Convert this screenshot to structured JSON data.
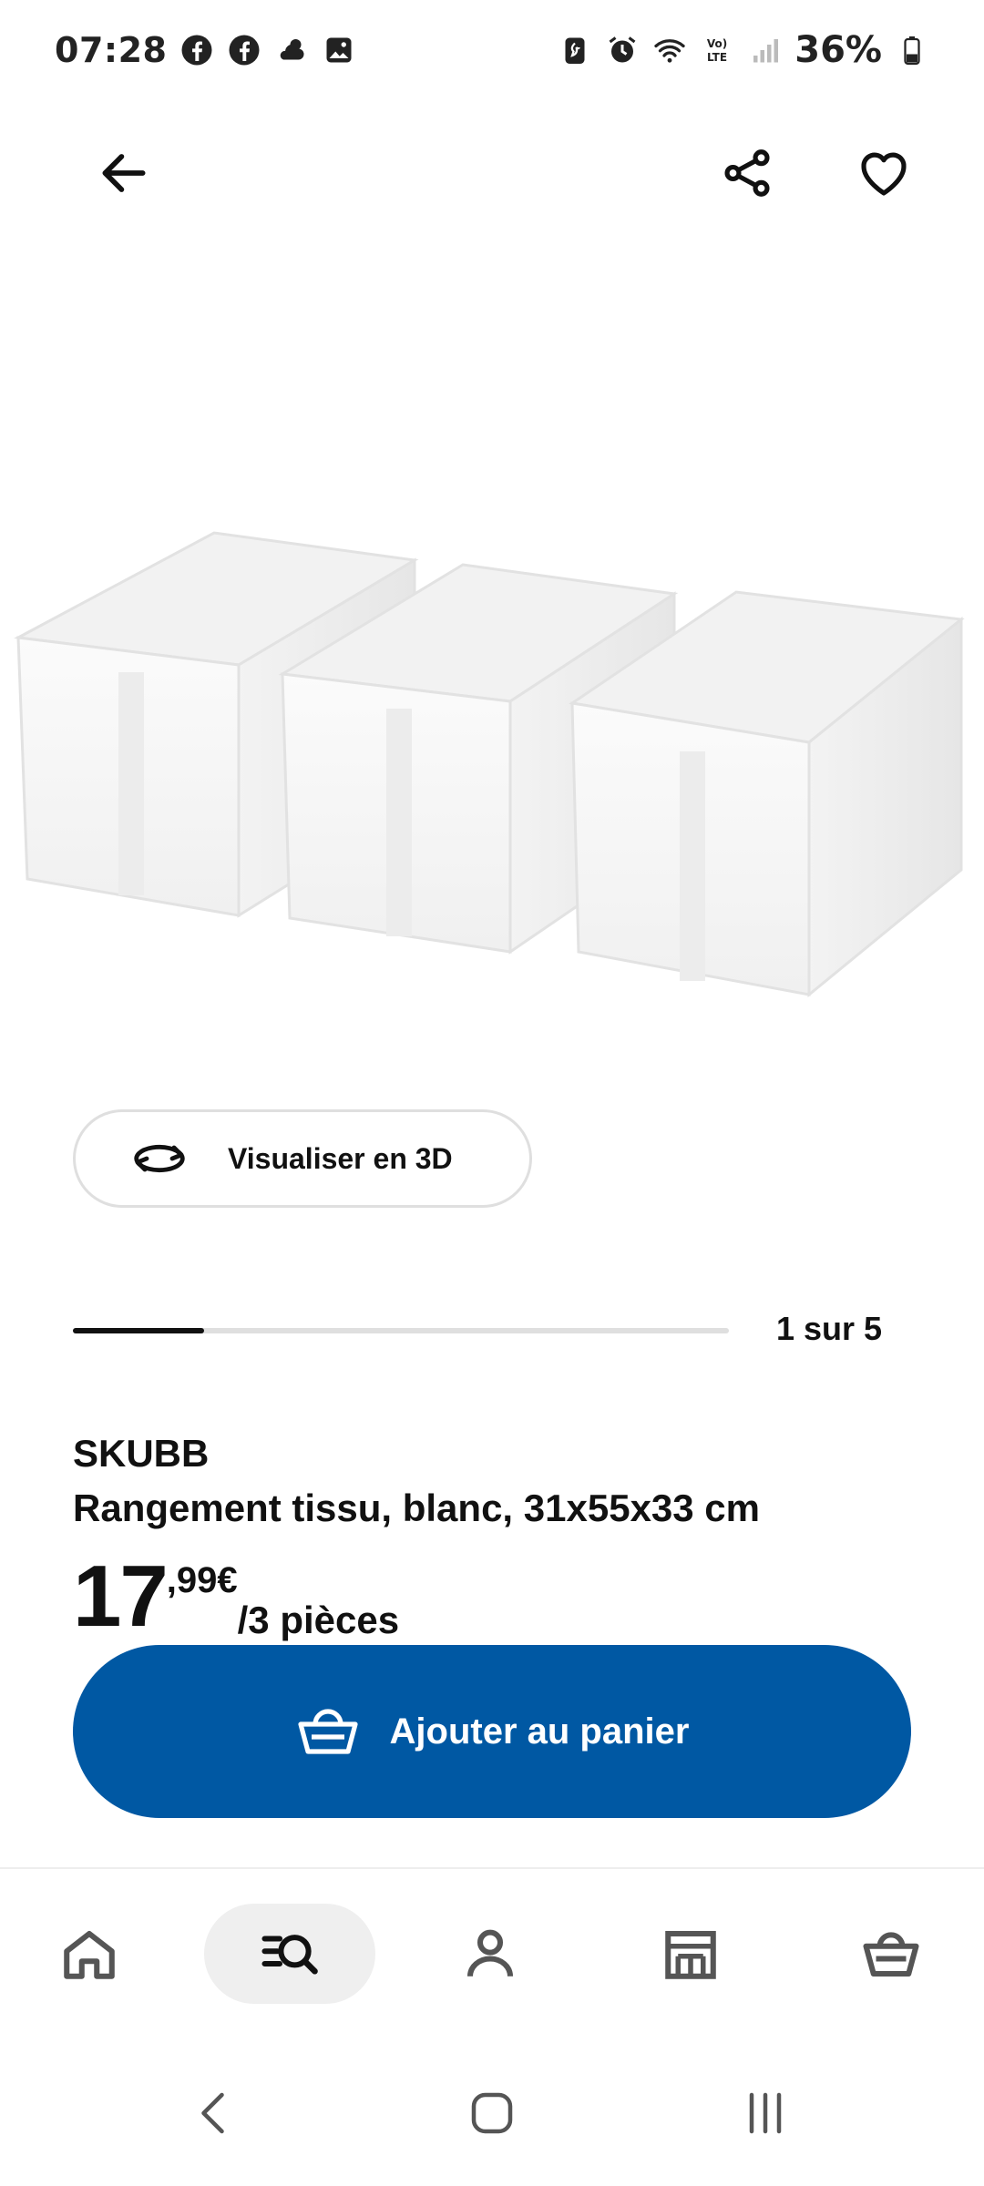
{
  "status_bar": {
    "time": "07:28",
    "battery": "36%",
    "icons_left": [
      "facebook-icon",
      "facebook-icon",
      "weather-icon",
      "gallery-icon"
    ],
    "icons_right": [
      "battery-saver-icon",
      "alarm-icon",
      "wifi-icon",
      "volte-icon",
      "signal-icon",
      "battery-icon"
    ]
  },
  "top_bar": {
    "back_icon": "arrow-left-icon",
    "share_icon": "share-icon",
    "favorite_icon": "heart-icon"
  },
  "product_image": {
    "description_icon": "storage-boxes-image"
  },
  "view_3d": {
    "label": "Visualiser en 3D",
    "icon": "rotate-3d-icon"
  },
  "carousel": {
    "label": "1 sur 5",
    "progress": 0.2
  },
  "product": {
    "name": "SKUBB",
    "description": "Rangement tissu, blanc, 31x55x33 cm",
    "price_integer": "17",
    "price_decimal": ",99€",
    "price_unit": "/3 pièces"
  },
  "cart_button": {
    "label": "Ajouter au panier",
    "icon": "basket-icon"
  },
  "bottom_nav": {
    "items": [
      {
        "icon": "home-icon",
        "active": false
      },
      {
        "icon": "search-icon",
        "active": true
      },
      {
        "icon": "profile-icon",
        "active": false
      },
      {
        "icon": "store-icon",
        "active": false
      },
      {
        "icon": "basket-icon",
        "active": false
      }
    ]
  },
  "colors": {
    "accent": "#0058a3",
    "text": "#111111",
    "border": "#dfdfdf",
    "nav_active_bg": "#efefef"
  }
}
